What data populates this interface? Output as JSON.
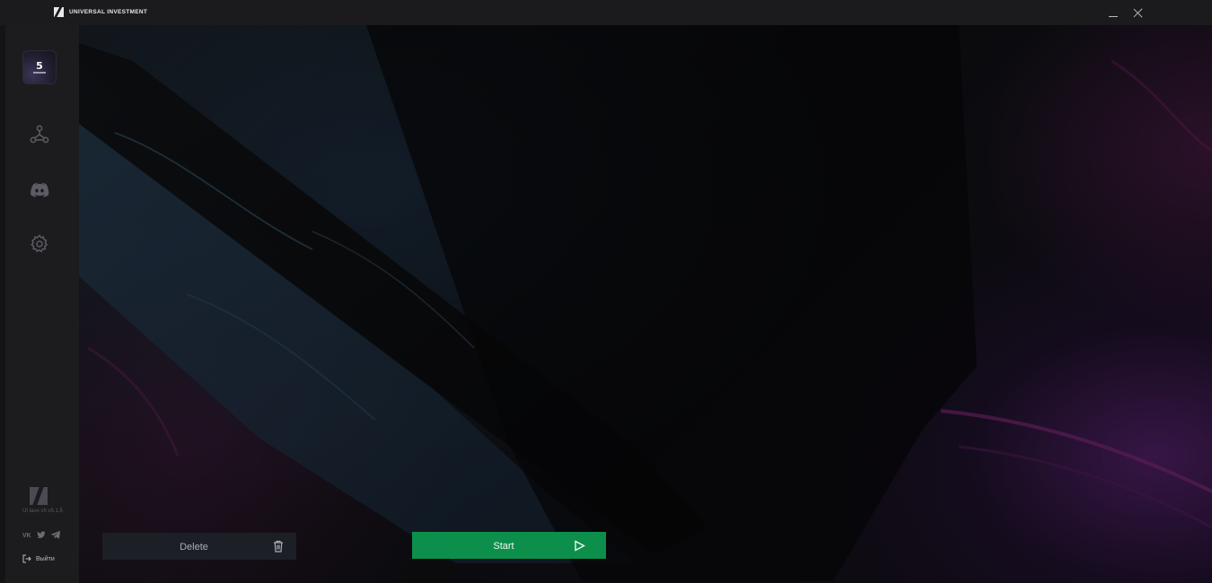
{
  "app": {
    "title": "UNIVERSAL INVESTMENT"
  },
  "window_controls": {
    "minimize_icon": "minimize-icon",
    "close_icon": "close-icon"
  },
  "sidebar": {
    "game_tile": {
      "mark": "5",
      "icon": "game-thumbnail"
    },
    "nav_items": [
      {
        "icon": "network-icon"
      },
      {
        "icon": "discord-icon"
      },
      {
        "icon": "gear-icon"
      }
    ],
    "footer": {
      "version": "UI lauч   ch  v5.1.5",
      "social": [
        "vk-icon",
        "twitter-icon",
        "telegram-icon"
      ],
      "logout_label": "Выйти"
    }
  },
  "actions": {
    "delete_label": "Delete",
    "start_label": "Start"
  },
  "colors": {
    "start_accent": "#0d8f4c",
    "delete_bg": "#1c2026",
    "sidebar_bg": "#1c1c1e",
    "titlebar_bg": "#1b1b1d"
  }
}
